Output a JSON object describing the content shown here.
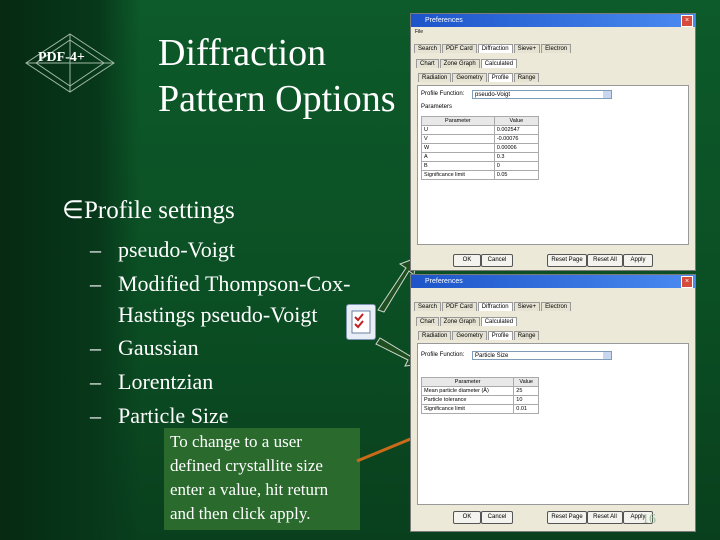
{
  "logo": {
    "text": "PDF-4+"
  },
  "title": {
    "line1": "Diffraction",
    "line2": "Pattern Options"
  },
  "bullet": {
    "mark": "Ú",
    "text": "Profile settings"
  },
  "sub_items": [
    {
      "text": "pseudo-Voigt"
    },
    {
      "text": "Modified Thompson-Cox-"
    },
    {
      "text": "Hastings pseudo-Voigt"
    },
    {
      "text": "Gaussian"
    },
    {
      "text": "Lorentzian"
    },
    {
      "text": "Particle Size"
    }
  ],
  "dash": "–",
  "note": {
    "text": "To change to a user defined crystallite size enter a value, hit return and then click apply."
  },
  "page_number": "16",
  "colors": {
    "background": "#0b4f24",
    "title_bar": "#1d55c9",
    "arrow_green": "#1f4e20",
    "arrow_orange": "#c86a1a"
  },
  "dialog1": {
    "title": "Preferences",
    "menu": "File",
    "tabs": [
      "Search",
      "PDF Card",
      "Diffraction",
      "Sieve+",
      "Electron"
    ],
    "subtabs": [
      "Chart",
      "Zone Graph",
      "Calculated"
    ],
    "subtabs2": [
      "Radiation",
      "Geometry",
      "Profile",
      "Range"
    ],
    "profile_label": "Profile Function:",
    "profile_value": "pseudo-Voigt",
    "params_label": "Parameters",
    "table": {
      "headers": [
        "Parameter",
        "Value"
      ],
      "rows": [
        [
          "U",
          "0.002547"
        ],
        [
          "V",
          "-0.00076"
        ],
        [
          "W",
          "0.00006"
        ],
        [
          "A",
          "0.3"
        ],
        [
          "B",
          "0"
        ],
        [
          "Significance limit",
          "0.05"
        ]
      ]
    },
    "buttons": [
      "OK",
      "Cancel",
      "Reset Page",
      "Reset All",
      "Apply"
    ]
  },
  "dialog2": {
    "title": "Preferences",
    "tabs": [
      "Search",
      "PDF Card",
      "Diffraction",
      "Sieve+",
      "Electron"
    ],
    "subtabs": [
      "Chart",
      "Zone Graph",
      "Calculated"
    ],
    "subtabs2": [
      "Radiation",
      "Geometry",
      "Profile",
      "Range"
    ],
    "profile_label": "Profile Function:",
    "profile_value": "Particle Size",
    "table": {
      "headers": [
        "Parameter",
        "Value"
      ],
      "rows": [
        [
          "Mean particle diameter (Å)",
          "25"
        ],
        [
          "Particle tolerance",
          "10"
        ],
        [
          "Significance limit",
          "0.01"
        ]
      ]
    },
    "buttons": [
      "OK",
      "Cancel",
      "Reset Page",
      "Reset All",
      "Apply"
    ]
  }
}
